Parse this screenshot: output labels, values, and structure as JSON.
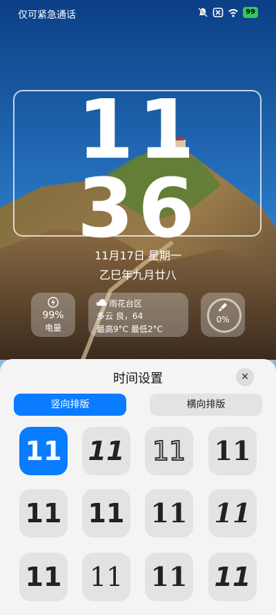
{
  "status_bar": {
    "carrier": "仅可紧急通话",
    "battery": "99",
    "icons": [
      "mute-icon",
      "no-sim-icon",
      "wifi-icon",
      "battery-icon"
    ]
  },
  "clock": {
    "hours": "11",
    "minutes": "36"
  },
  "date": {
    "gregorian": "11月17日 星期一",
    "lunar": "乙巳年九月廿八"
  },
  "widgets": {
    "battery": {
      "value": "99%",
      "label": "电量"
    },
    "weather": {
      "location": "雨花台区",
      "condition": "多云 良，64",
      "temps": "最高9°C  最低2°C"
    },
    "ring": {
      "value": "0%"
    }
  },
  "sheet": {
    "title": "时间设置",
    "tabs": [
      {
        "label": "竖向排版"
      },
      {
        "label": "横向排版"
      }
    ],
    "styles": [
      "11",
      "11",
      "11",
      "11",
      "11",
      "11",
      "11",
      "11",
      "11",
      "11",
      "11",
      "11"
    ]
  },
  "colors": {
    "accent": "#0a7cff",
    "sheet_bg": "#f4f4f4",
    "tile_bg": "#e3e3e3"
  }
}
